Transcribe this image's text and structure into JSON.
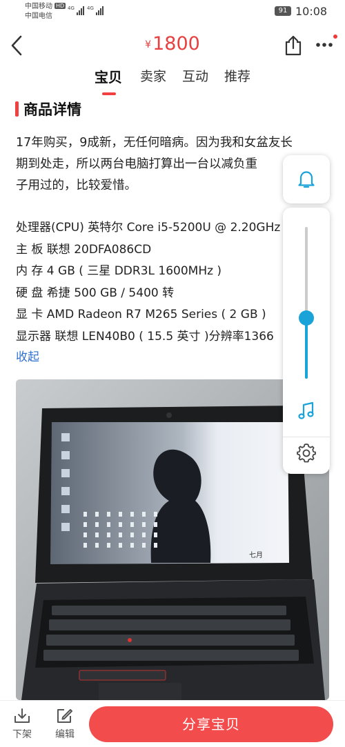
{
  "status_bar": {
    "carrier_1": "中国移动",
    "carrier_1_badge": "HD",
    "carrier_2": "中国电信",
    "net_1": "4G",
    "net_2": "4G",
    "battery": "91",
    "time": "10:08"
  },
  "header": {
    "price_symbol": "¥",
    "price": "1800",
    "tabs": [
      {
        "label": "宝贝",
        "active": true
      },
      {
        "label": "卖家",
        "active": false
      },
      {
        "label": "互动",
        "active": false
      },
      {
        "label": "推荐",
        "active": false
      }
    ],
    "icons": {
      "back": "back-chevron-icon",
      "share": "share-icon",
      "more": "more-icon"
    }
  },
  "section": {
    "title": "商品详情"
  },
  "description": {
    "lines": [
      "17年购买，9成新，无任何暗病。因为我和女盆友长",
      "期到处走，所以两台电脑打算出一台以减负重",
      "子用过的，比较爱惜。"
    ]
  },
  "specs": {
    "lines": [
      "处理器(CPU) 英特尔 Core i5-5200U @ 2.20GHz",
      "主 板 联想 20DFA086CD",
      "内 存 4 GB ( 三星 DDR3L 1600MHz )",
      "硬 盘 希捷 500 GB / 5400 转",
      "显 卡 AMD Radeon R7 M265 Series ( 2 GB )",
      "显示器 联想 LEN40B0 ( 15.5 英寸 )分辨率1366"
    ],
    "collapse_label": "收起"
  },
  "photo": {
    "alt": "laptop-photo",
    "screen_text": "七月"
  },
  "float_panel": {
    "icons": {
      "bell": "bell-icon",
      "music": "music-icon",
      "settings": "gear-icon"
    },
    "volume_level": 0.4,
    "accent": "#19a3d8"
  },
  "bottom_bar": {
    "delist_label": "下架",
    "edit_label": "编辑",
    "share_label": "分享宝贝",
    "accent": "#f34c4c"
  }
}
